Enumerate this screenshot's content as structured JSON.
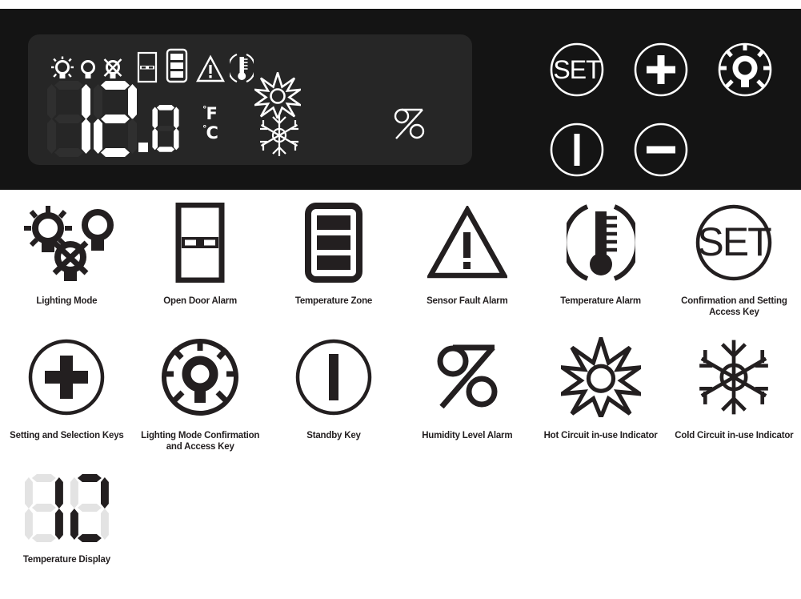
{
  "panel": {
    "display": {
      "temperature_value": "12.0",
      "digits": [
        "1",
        "2",
        "0"
      ],
      "decimal_point": ".",
      "unit_fahrenheit": "F",
      "unit_celsius": "C",
      "degree_symbol": "°",
      "humidity_symbol": "%",
      "status_icons": [
        "lighting-on-icon",
        "lighting-bulb-icon",
        "lighting-off-icon",
        "open-door-alarm-icon",
        "temperature-zone-icon",
        "sensor-fault-alarm-icon",
        "temperature-alarm-icon",
        "hot-circuit-indicator-icon",
        "cold-circuit-indicator-icon",
        "humidity-level-alarm-icon"
      ]
    },
    "keys": [
      {
        "name": "set-key",
        "label": "SET",
        "icon": "set-icon"
      },
      {
        "name": "plus-key",
        "label": "+",
        "icon": "plus-icon"
      },
      {
        "name": "lighting-mode-key",
        "label": "",
        "icon": "lighting-mode-ring-icon"
      },
      {
        "name": "standby-key",
        "label": "I",
        "icon": "standby-icon"
      },
      {
        "name": "minus-key",
        "label": "−",
        "icon": "minus-icon"
      }
    ],
    "colors": {
      "panel_background": "#141414",
      "lcd_background": "#262626",
      "lcd_foreground": "#ffffff",
      "lcd_segment_off": "#2f2f2f",
      "legend_ink": "#231f20",
      "page_background": "#ffffff"
    }
  },
  "legend": {
    "rows": [
      [
        {
          "icon": "lighting-mode-icon",
          "label": "Lighting Mode"
        },
        {
          "icon": "open-door-alarm-icon",
          "label": "Open Door Alarm"
        },
        {
          "icon": "temperature-zone-icon",
          "label": "Temperature Zone"
        },
        {
          "icon": "sensor-fault-alarm-icon",
          "label": "Sensor Fault Alarm"
        },
        {
          "icon": "temperature-alarm-icon",
          "label": "Temperature Alarm"
        },
        {
          "icon": "set-icon",
          "label": "Confirmation and Setting Access Key"
        }
      ],
      [
        {
          "icon": "plus-icon",
          "label": "Setting and Selection Keys"
        },
        {
          "icon": "lighting-mode-ring-icon",
          "label": "Lighting Mode Confirmation and Access Key"
        },
        {
          "icon": "standby-icon",
          "label": "Standby Key"
        },
        {
          "icon": "humidity-level-alarm-icon",
          "label": "Humidity Level Alarm"
        },
        {
          "icon": "hot-circuit-indicator-icon",
          "label": "Hot Circuit in-use Indicator"
        },
        {
          "icon": "cold-circuit-indicator-icon",
          "label": "Cold Circuit in-use Indicator"
        }
      ],
      [
        {
          "icon": "temperature-display-icon",
          "label": "Temperature Display"
        }
      ]
    ]
  }
}
